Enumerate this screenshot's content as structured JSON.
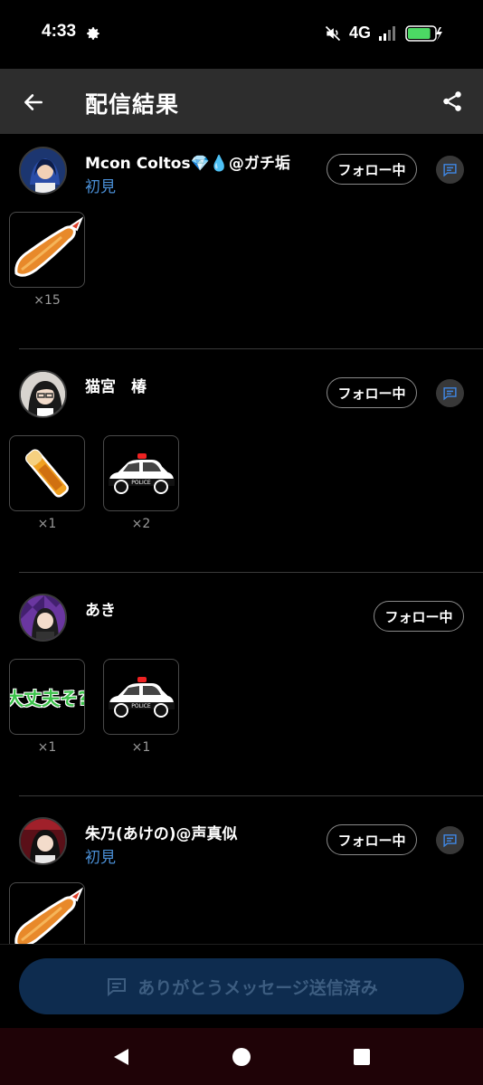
{
  "status_bar": {
    "time": "4:33",
    "network": "4G",
    "battery_percent": 85
  },
  "app_bar": {
    "title": "配信結果"
  },
  "viewers": [
    {
      "name": "Mcon Coltos💎💧@ガチ垢",
      "tag": "初見",
      "follow_label": "フォロー中",
      "has_message": true,
      "gifts": [
        {
          "icon": "fried-shrimp-icon",
          "count": "×15"
        }
      ]
    },
    {
      "name": "猫宮　椿",
      "tag": "",
      "follow_label": "フォロー中",
      "has_message": true,
      "gifts": [
        {
          "icon": "glowstick-icon",
          "count": "×1"
        },
        {
          "icon": "police-car-icon",
          "count": "×2"
        }
      ]
    },
    {
      "name": "あき",
      "tag": "",
      "follow_label": "フォロー中",
      "has_message": false,
      "gifts": [
        {
          "icon": "daijoubu-sticker-icon",
          "label": "大丈夫そ?",
          "count": "×1"
        },
        {
          "icon": "police-car-icon",
          "count": "×1"
        }
      ]
    },
    {
      "name": "朱乃(あけの)@声真似",
      "tag": "初見",
      "follow_label": "フォロー中",
      "has_message": true,
      "gifts": [
        {
          "icon": "fried-shrimp-icon",
          "count": ""
        }
      ]
    }
  ],
  "police_label": "POLICE",
  "footer": {
    "thanks_label": "ありがとうメッセージ送信済み"
  },
  "colors": {
    "accent_blue": "#4a8fd6",
    "thanks_bg": "#0e2c4f",
    "nav_bg": "#1f0307"
  }
}
